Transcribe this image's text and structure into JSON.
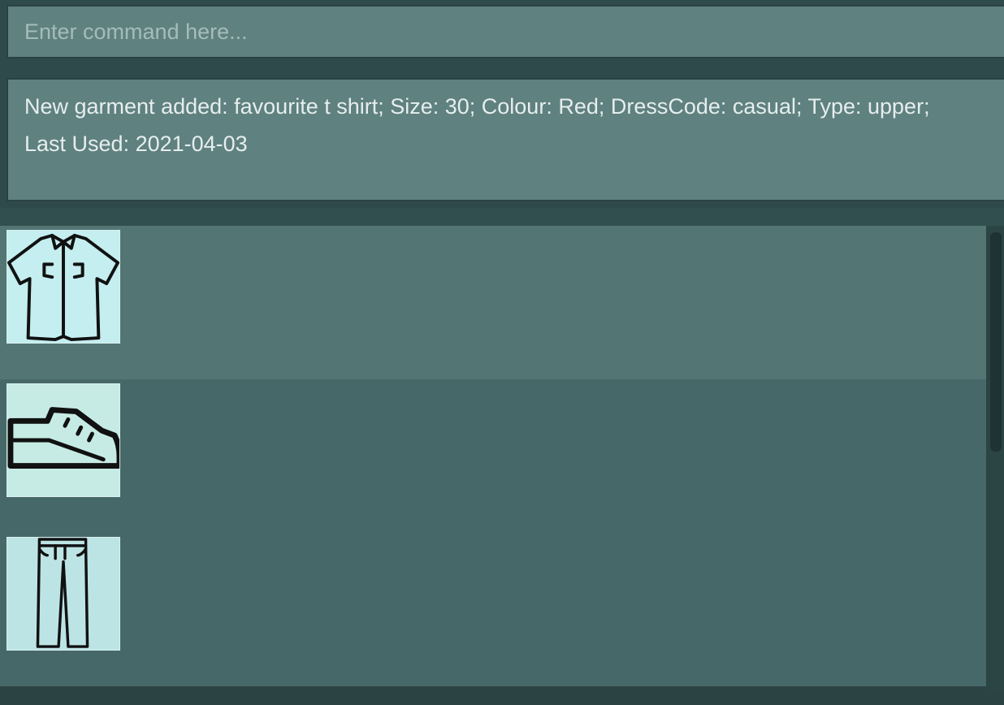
{
  "command_box": {
    "placeholder": "Enter command here...",
    "value": ""
  },
  "result_display": {
    "text": "New garment added: favourite t shirt; Size: 30; Colour: Red; DressCode: casual; Type: upper;\nLast Used: 2021-04-03"
  },
  "garment_list": {
    "items": [
      {
        "icon": "shirt-icon",
        "thumb_bg": "#c4eef0"
      },
      {
        "icon": "shoe-icon",
        "thumb_bg": "#c6ebe4"
      },
      {
        "icon": "pants-icon",
        "thumb_bg": "#bce4e5"
      }
    ]
  },
  "colors": {
    "background": "#2f4a4b",
    "input_bg": "#5f8180",
    "list_odd": "#537574",
    "list_even": "#476868"
  }
}
